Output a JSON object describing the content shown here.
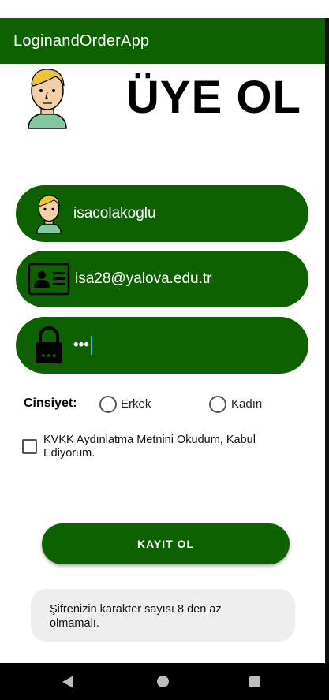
{
  "app": {
    "title": "LoginandOrderApp"
  },
  "page": {
    "heading": "ÜYE OL"
  },
  "form": {
    "username": {
      "value": "isacolakoglu",
      "icon": "user-avatar-icon"
    },
    "email": {
      "value": "isa28@yalova.edu.tr",
      "icon": "id-card-icon"
    },
    "password": {
      "value": "•••",
      "icon": "lock-icon"
    }
  },
  "gender": {
    "label": "Cinsiyet:",
    "options": [
      "Erkek",
      "Kadın"
    ]
  },
  "kvkk": {
    "label": "KVKK Aydınlatma Metnini Okudum, Kabul Ediyorum.",
    "checked": false
  },
  "register_button": {
    "label": "KAYIT OL"
  },
  "toast": {
    "message": "Şifrenizin karakter sayısı 8 den az olmamalı."
  },
  "navbar": {
    "back": "back-icon",
    "home": "home-icon",
    "recents": "recents-icon"
  },
  "colors": {
    "primary": "#0e6100",
    "toast_bg": "#eeeeee"
  }
}
